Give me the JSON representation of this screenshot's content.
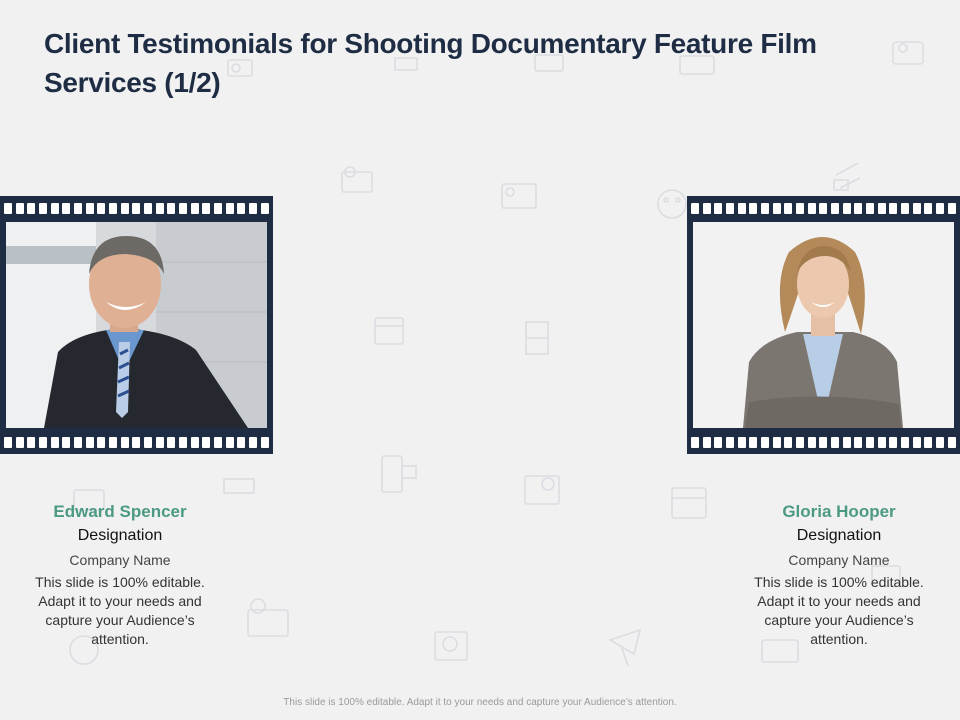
{
  "slide": {
    "title": "Client Testimonials for Shooting Documentary Feature Film Services (1/2)",
    "footer": "This slide is 100% editable.  Adapt it to your needs and capture your Audience’s attention."
  },
  "testimonials": [
    {
      "name": "Edward Spencer",
      "designation": "Designation",
      "company": "Company Name",
      "description": "This slide is 100% editable. Adapt it to your needs and capture your Audience’s attention."
    },
    {
      "name": "Gloria Hooper",
      "designation": "Designation",
      "company": "Company Name",
      "description": "This slide is 100% editable. Adapt it to your needs and capture your Audience’s attention."
    }
  ],
  "colors": {
    "background": "#f1f1f2",
    "title": "#1f2d44",
    "filmstrip": "#1f2d44",
    "accent_name": "#4c9a84"
  },
  "icons": [
    "film-camera-icon",
    "clapperboard-icon",
    "film-reel-icon",
    "theater-mask-icon",
    "projector-icon",
    "video-camera-icon"
  ]
}
